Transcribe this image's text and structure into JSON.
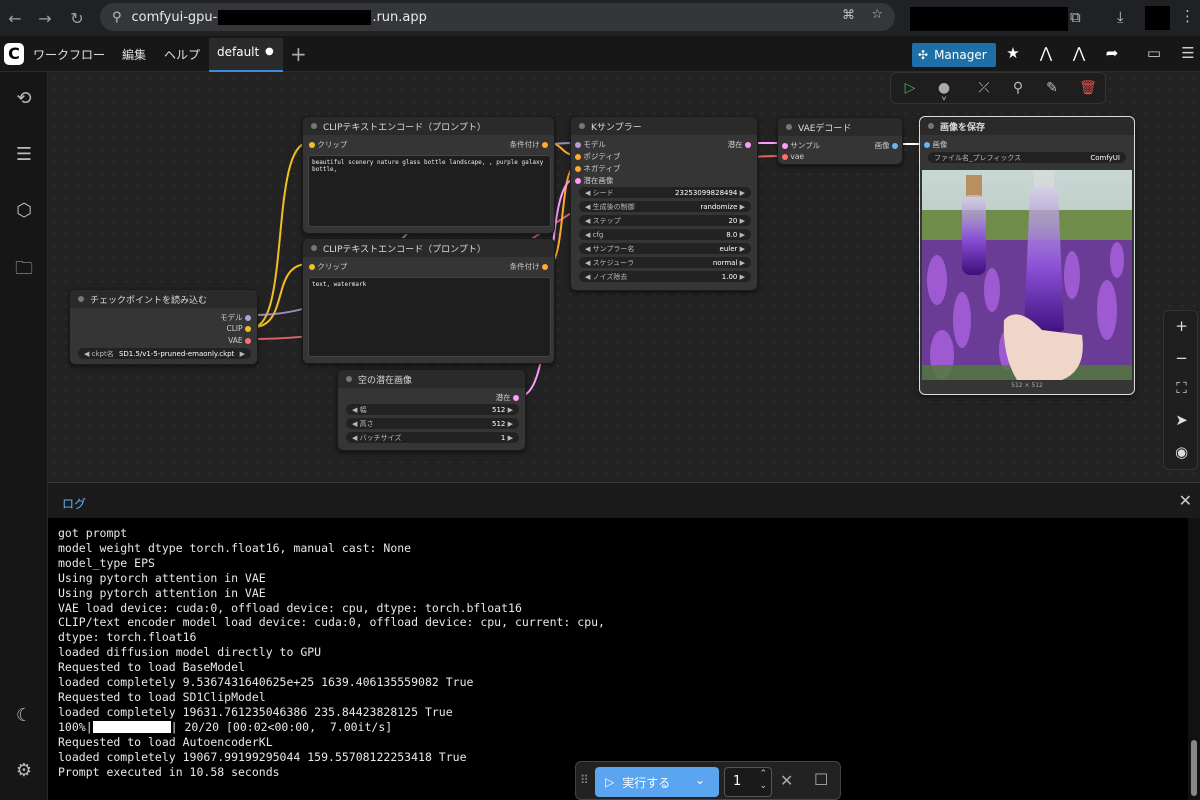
{
  "browser": {
    "url_prefix": "comfyui-gpu-",
    "url_suffix": ".run.app"
  },
  "header": {
    "logo": "C",
    "menu": [
      "ワークフロー",
      "編集",
      "ヘルプ"
    ],
    "tab_label": "default",
    "tab_dot": "●",
    "new_tab": "+",
    "manager_label": "Manager"
  },
  "nodes": {
    "clip_top": {
      "title": "CLIPテキストエンコード（プロンプト）",
      "in_clip": "クリップ",
      "out_cond": "条件付け",
      "text": "beautiful scenery nature glass bottle landscape, , purple galaxy bottle,"
    },
    "clip_bottom": {
      "title": "CLIPテキストエンコード（プロンプト）",
      "in_clip": "クリップ",
      "out_cond": "条件付け",
      "text": "text, watermark"
    },
    "checkpoint": {
      "title": "チェックポイントを読み込む",
      "out_model": "モデル",
      "out_clip": "CLIP",
      "out_vae": "VAE",
      "ckpt_label": "ckpt名",
      "ckpt_value": "SD1.5/v1-5-pruned-emaonly.ckpt"
    },
    "empty_latent": {
      "title": "空の潜在画像",
      "out_latent": "潜在",
      "widgets": [
        {
          "label": "幅",
          "value": "512"
        },
        {
          "label": "高さ",
          "value": "512"
        },
        {
          "label": "バッチサイズ",
          "value": "1"
        }
      ]
    },
    "ksampler": {
      "title": "Kサンプラー",
      "inputs": [
        "モデル",
        "ポジティブ",
        "ネガティブ",
        "潜在画像"
      ],
      "out_latent": "潜在",
      "widgets": [
        {
          "label": "シード",
          "value": "23253099828494"
        },
        {
          "label": "生成後の制御",
          "value": "randomize"
        },
        {
          "label": "ステップ",
          "value": "20"
        },
        {
          "label": "cfg",
          "value": "8.0"
        },
        {
          "label": "サンプラー名",
          "value": "euler"
        },
        {
          "label": "スケジューラ",
          "value": "normal"
        },
        {
          "label": "ノイズ除去",
          "value": "1.00"
        }
      ]
    },
    "vae_decode": {
      "title": "VAEデコード",
      "in_samples": "サンプル",
      "in_vae": "vae",
      "out_image": "画像"
    },
    "save_image": {
      "title": "画像を保存",
      "in_image": "画像",
      "prefix_label": "ファイル名_プレフィックス",
      "prefix_value": "ComfyUI",
      "size": "512 × 512"
    }
  },
  "log": {
    "title": "ログ",
    "lines": [
      "got prompt",
      "model weight dtype torch.float16, manual cast: None",
      "model_type EPS",
      "Using pytorch attention in VAE",
      "Using pytorch attention in VAE",
      "VAE load device: cuda:0, offload device: cpu, dtype: torch.bfloat16",
      "CLIP/text encoder model load device: cuda:0, offload device: cpu, current: cpu,",
      "dtype: torch.float16",
      "loaded diffusion model directly to GPU",
      "Requested to load BaseModel",
      "loaded completely 9.5367431640625e+25 1639.406135559082 True",
      "Requested to load SD1ClipModel",
      "loaded completely 19631.761235046386 235.84423828125 True"
    ],
    "progress_prefix": "100%|",
    "progress_suffix": "| 20/20 [00:02<00:00,  7.00it/s]",
    "lines_after": [
      "Requested to load AutoencoderKL",
      "loaded completely 19067.99199295044 159.55708122253418 True",
      "Prompt executed in 10.58 seconds"
    ]
  },
  "run_bar": {
    "run_label": "実行する",
    "count": "1"
  },
  "colors": {
    "accent": "#5aa4f0",
    "manager": "#1e6fa8",
    "clip_wire": "#f0c020",
    "model_wire": "#b39ddb",
    "vae_wire": "#ff6e6e",
    "latent_wire": "#ff9cf9",
    "cond_wire": "#ffa931",
    "image_wire": "#64b5f6"
  }
}
